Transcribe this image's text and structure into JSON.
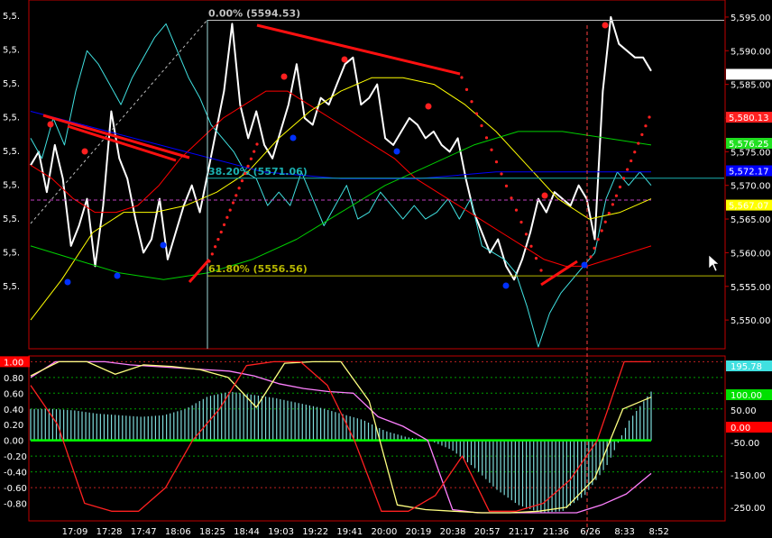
{
  "chart_data": [
    {
      "type": "line",
      "name": "price-panel",
      "ylim": [
        5546,
        5597
      ],
      "y_ticks": [
        5550,
        5555,
        5560,
        5565,
        5570,
        5575,
        5580,
        5585,
        5590,
        5595
      ],
      "y_tick_labels": [
        "5,550.00",
        "5,555.00",
        "5,560.00",
        "5,565.00",
        "5,570.00",
        "5,575.00",
        "5,580.00",
        "5,585.00",
        "5,590.00",
        "5,595.00"
      ],
      "left_tick_labels": [
        "5,5.",
        "5,5.",
        "5,5.",
        "5,5.",
        "5,5.",
        "5,5.",
        "5,5.",
        "5,5.",
        "5,5."
      ],
      "x_labels": [
        "17:09",
        "17:28",
        "17:47",
        "18:06",
        "18:25",
        "18:44",
        "19:03",
        "19:22",
        "19:41",
        "20:00",
        "20:19",
        "20:38",
        "20:57",
        "21:17",
        "21:36",
        "6/26",
        "8:33",
        "8:52"
      ],
      "fibonacci": [
        {
          "label": "0.00% (5594.53)",
          "value": 5594.53,
          "color": "#c0c0c0"
        },
        {
          "label": "38.20% (5571.06)",
          "value": 5571.06,
          "color": "#1ab0b0"
        },
        {
          "label": "61.80% (5556.56)",
          "value": 5556.56,
          "color": "#b8b800"
        }
      ],
      "value_badges": [
        {
          "label": "5,586.50",
          "value": 5586.5,
          "bg": "#ffffff",
          "fg": "#000000"
        },
        {
          "label": "5,580.13",
          "value": 5580.13,
          "bg": "#ff2020",
          "fg": "#000000"
        },
        {
          "label": "5,576.25",
          "value": 5576.25,
          "bg": "#20e020",
          "fg": "#000000"
        },
        {
          "label": "5,572.17",
          "value": 5572.17,
          "bg": "#0000ff",
          "fg": "#000000"
        },
        {
          "label": "5,567.07",
          "value": 5567.07,
          "bg": "#ffff00",
          "fg": "#000000"
        }
      ],
      "series": [
        {
          "color": "#ffffff",
          "values": [
            5573,
            5575,
            5569,
            5576,
            5571,
            5561,
            5564,
            5568,
            5558,
            5567,
            5581,
            5574,
            5571,
            5565,
            5560,
            5562,
            5568,
            5559,
            5563,
            5567,
            5570,
            5566,
            5572,
            5578,
            5584,
            5594,
            5582,
            5577,
            5581,
            5576,
            5574,
            5578,
            5582,
            5588,
            5580,
            5579,
            5583,
            5582,
            5585,
            5588,
            5589,
            5582,
            5583,
            5585,
            5577,
            5576,
            5578,
            5580,
            5579,
            5577,
            5578,
            5576,
            5575,
            5577,
            5571,
            5566,
            5563,
            5560,
            5562,
            5558,
            5556,
            5559,
            5563,
            5568,
            5566,
            5569,
            5568,
            5567,
            5570,
            5568,
            5562,
            5584,
            5595,
            5591,
            5590,
            5589,
            5589,
            5587
          ]
        },
        {
          "color": "#40e0e0",
          "values": [
            5577,
            5574,
            5580,
            5576,
            5584,
            5590,
            5588,
            5585,
            5582,
            5586,
            5589,
            5592,
            5594,
            5590,
            5586,
            5583,
            5579,
            5577,
            5575,
            5572,
            5571,
            5567,
            5569,
            5567,
            5572,
            5568,
            5564,
            5567,
            5570,
            5565,
            5566,
            5569,
            5567,
            5565,
            5567,
            5565,
            5566,
            5568,
            5565,
            5568,
            5561,
            5560,
            5559,
            5557,
            5552,
            5546,
            5551,
            5554,
            5556,
            5558,
            5560,
            5568,
            5572,
            5570,
            5572,
            5570
          ]
        },
        {
          "color": "#ff0000",
          "values": [
            5573,
            5571,
            5568,
            5566,
            5566,
            5567,
            5570,
            5574,
            5577,
            5580,
            5582,
            5584,
            5584,
            5582,
            5580,
            5578,
            5576,
            5574,
            5571,
            5569,
            5567,
            5565,
            5563,
            5561,
            5559,
            5558,
            5558,
            5559,
            5560,
            5561
          ]
        },
        {
          "color": "#ffff00",
          "values": [
            5550,
            5556,
            5563,
            5566,
            5566,
            5567,
            5569,
            5572,
            5577,
            5581,
            5584,
            5586,
            5586,
            5585,
            5582,
            5578,
            5573,
            5568,
            5565,
            5566,
            5568
          ]
        },
        {
          "color": "#00d000",
          "values": [
            5561,
            5559,
            5557,
            5556,
            5557,
            5559,
            5562,
            5566,
            5570,
            5573,
            5576,
            5578,
            5578,
            5577,
            5576
          ]
        },
        {
          "color": "#0000ff",
          "values": [
            5581,
            5578,
            5575,
            5572,
            5571,
            5571,
            5572,
            5572,
            5572
          ]
        }
      ]
    },
    {
      "type": "line",
      "name": "oscillator-panel",
      "ylim": [
        -1.0,
        1.05
      ],
      "y_ticks": [
        -0.8,
        -0.6,
        -0.4,
        -0.2,
        0.0,
        0.2,
        0.4,
        0.6,
        0.8,
        1.0
      ],
      "y_tick_labels": [
        "-0.80",
        "-0.60",
        "-0.40",
        "-0.20",
        "0.00",
        "0.20",
        "0.40",
        "0.60",
        "0.80",
        "1.00"
      ],
      "right_tick_labels": [
        "-250.00",
        "-150.00",
        "-50.00",
        "50.00"
      ],
      "value_badges": [
        {
          "label": "195.78",
          "bg": "#40e0e0",
          "fg": "#000000"
        },
        {
          "label": "100.00",
          "bg": "#00e000",
          "fg": "#000000"
        },
        {
          "label": "0.00",
          "bg": "#ff0000",
          "fg": "#000000"
        }
      ],
      "y_label_badge": {
        "label": "1.00",
        "bg": "#ff0000",
        "fg": "#000000"
      },
      "series": [
        {
          "color": "#7fdcdc",
          "values": [
            0.4,
            0.4,
            0.38,
            0.34,
            0.32,
            0.3,
            0.32,
            0.4,
            0.56,
            0.62,
            0.58,
            0.54,
            0.48,
            0.42,
            0.34,
            0.26,
            0.12,
            0.04,
            0.0,
            -0.12,
            -0.34,
            -0.62,
            -0.82,
            -0.92,
            -0.9,
            -0.7,
            -0.32,
            0.25,
            0.62
          ]
        },
        {
          "color": "#ff80ff",
          "values": [
            0.8,
            1.0,
            1.0,
            1.0,
            0.96,
            0.94,
            0.92,
            0.9,
            0.88,
            0.82,
            0.72,
            0.66,
            0.62,
            0.6,
            0.3,
            0.18,
            0.0,
            -0.88,
            -0.92,
            -0.92,
            -0.92,
            -0.92,
            -0.92,
            -0.82,
            -0.68,
            -0.42
          ]
        },
        {
          "color": "#ffff80",
          "values": [
            0.82,
            1.0,
            1.0,
            0.84,
            0.96,
            0.94,
            0.9,
            0.8,
            0.42,
            0.98,
            1.0,
            1.0,
            0.5,
            -0.82,
            -0.88,
            -0.9,
            -0.92,
            -0.92,
            -0.9,
            -0.85,
            -0.48,
            0.4,
            0.55
          ]
        },
        {
          "color": "#ff2020",
          "values": [
            0.7,
            0.2,
            -0.8,
            -0.9,
            -0.9,
            -0.6,
            0.0,
            0.4,
            0.95,
            1.0,
            1.0,
            0.7,
            0.0,
            -0.9,
            -0.9,
            -0.7,
            -0.2,
            -0.9,
            -0.9,
            -0.8,
            -0.5,
            0.0,
            1.0,
            1.0
          ]
        }
      ]
    }
  ]
}
